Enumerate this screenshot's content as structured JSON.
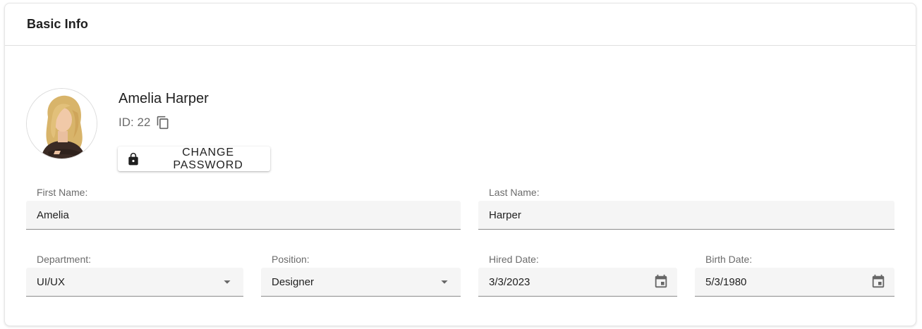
{
  "card": {
    "title": "Basic Info"
  },
  "profile": {
    "name": "Amelia Harper",
    "id_text": "ID: 22",
    "change_password_label": "CHANGE PASSWORD"
  },
  "form": {
    "first_name": {
      "label": "First Name:",
      "value": "Amelia"
    },
    "last_name": {
      "label": "Last Name:",
      "value": "Harper"
    },
    "department": {
      "label": "Department:",
      "value": "UI/UX"
    },
    "position": {
      "label": "Position:",
      "value": "Designer"
    },
    "hired_date": {
      "label": "Hired Date:",
      "value": "3/3/2023"
    },
    "birth_date": {
      "label": "Birth Date:",
      "value": "5/3/1980"
    }
  },
  "icons": {
    "copy": "copy-icon",
    "lock": "lock-icon",
    "dropdown": "arrow-drop-down-icon",
    "calendar": "calendar-icon"
  },
  "colors": {
    "field_background": "#f5f5f5",
    "field_underline": "#8c8c8c",
    "label_text": "#6b6b6b",
    "icon": "#666666"
  }
}
